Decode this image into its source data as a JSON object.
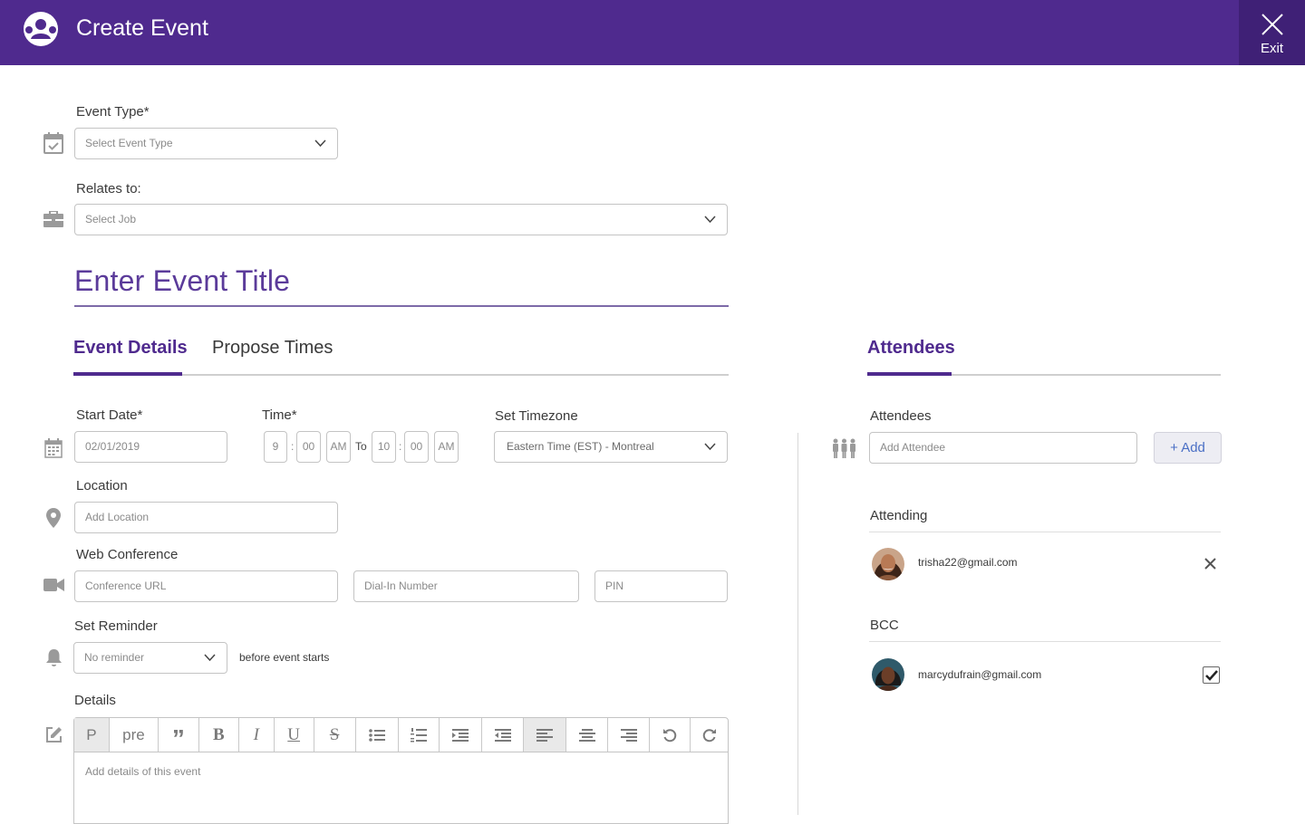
{
  "header": {
    "title": "Create Event",
    "exit_label": "Exit"
  },
  "event_type": {
    "label": "Event Type*",
    "placeholder": "Select Event Type"
  },
  "relates_to": {
    "label": "Relates to:",
    "placeholder": "Select Job"
  },
  "event_title": {
    "placeholder": "Enter Event Title"
  },
  "tabs": [
    {
      "label": "Event Details",
      "active": true
    },
    {
      "label": "Propose Times",
      "active": false
    }
  ],
  "start_date": {
    "label": "Start Date*",
    "value": "02/01/2019"
  },
  "time": {
    "label": "Time*",
    "start_hour": "9",
    "start_min": "00",
    "start_ampm": "AM",
    "to_label": "To",
    "end_hour": "10",
    "end_min": "00",
    "end_ampm": "AM",
    "colon": ":"
  },
  "timezone": {
    "label": "Set Timezone",
    "value": "Eastern Time (EST) - Montreal"
  },
  "location": {
    "label": "Location",
    "placeholder": "Add Location"
  },
  "web_conference": {
    "label": "Web Conference",
    "url_placeholder": "Conference URL",
    "dial_placeholder": "Dial-In Number",
    "pin_placeholder": "PIN"
  },
  "reminder": {
    "label": "Set Reminder",
    "value": "No reminder",
    "suffix": "before event starts"
  },
  "details": {
    "label": "Details",
    "placeholder": "Add details of this event",
    "toolbar": [
      {
        "name": "paragraph",
        "text": "P",
        "active": true
      },
      {
        "name": "pre",
        "text": "pre"
      },
      {
        "name": "quote",
        "text": "”"
      },
      {
        "name": "bold",
        "text": "B"
      },
      {
        "name": "italic",
        "text": "I"
      },
      {
        "name": "underline",
        "text": "U"
      },
      {
        "name": "strikethrough",
        "text": "S"
      },
      {
        "name": "bullet-list",
        "text": ""
      },
      {
        "name": "numbered-list",
        "text": ""
      },
      {
        "name": "indent",
        "text": ""
      },
      {
        "name": "outdent",
        "text": ""
      },
      {
        "name": "align-left",
        "text": "",
        "active": true
      },
      {
        "name": "align-center",
        "text": ""
      },
      {
        "name": "align-right",
        "text": ""
      },
      {
        "name": "undo",
        "text": ""
      },
      {
        "name": "redo",
        "text": ""
      }
    ]
  },
  "attendees_panel": {
    "tab_label": "Attendees",
    "field_label": "Attendees",
    "placeholder": "Add Attendee",
    "add_label": "+ Add",
    "attending_label": "Attending",
    "attending": [
      {
        "email": "trisha22@gmail.com"
      }
    ],
    "bcc_label": "BCC",
    "bcc": [
      {
        "email": "marcydufrain@gmail.com",
        "checked": true
      }
    ]
  },
  "colors": {
    "brand": "#4f2a8e",
    "brand_dark": "#3f2076",
    "link": "#4a6fc5"
  }
}
